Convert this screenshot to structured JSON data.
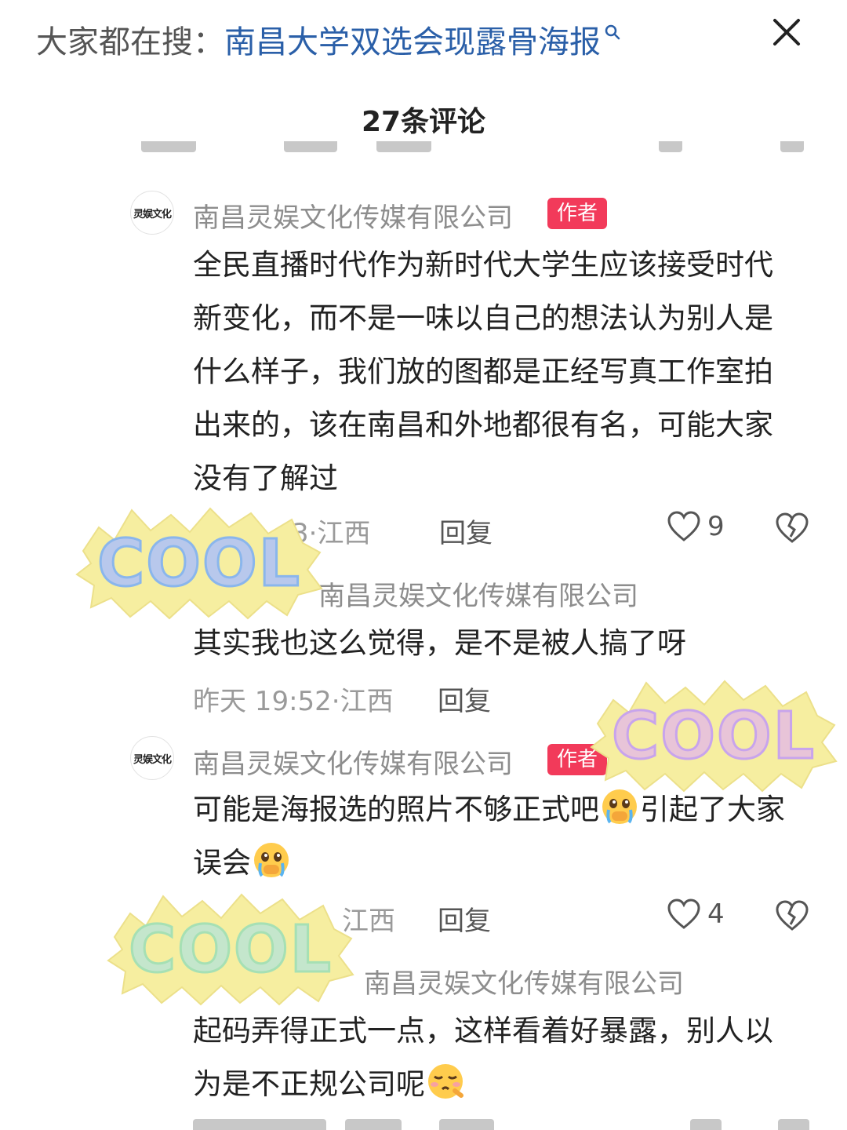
{
  "header": {
    "search_prefix": "大家都在搜：",
    "search_term": "南昌大学双选会现露骨海报",
    "comment_count": "27条评论"
  },
  "comments": [
    {
      "avatar_text": "灵娱文化",
      "username": "南昌灵娱文化传媒有限公司",
      "badge": "作者",
      "text": "全民直播时代作为新时代大学生应该接受时代新变化，而不是一味以自己的想法认为别人是什么样子，我们放的图都是正经写真工作室拍出来的，该在南昌和外地都很有名，可能大家没有了解过",
      "meta": "3·江西",
      "reply": "回复",
      "likes": "9"
    },
    {
      "username": "南昌灵娱文化传媒有限公司",
      "text": "其实我也这么觉得，是不是被人搞了呀",
      "meta": "昨天 19:52·江西",
      "reply": "回复"
    },
    {
      "avatar_text": "灵娱文化",
      "username": "南昌灵娱文化传媒有限公司",
      "badge": "作者",
      "text_a": "可能是海报选的照片不够正式吧",
      "text_b": "引起了大家误会",
      "meta": "江西",
      "reply": "回复",
      "likes": "4"
    },
    {
      "username": "南昌灵娱文化传媒有限公司",
      "text": "起码弄得正式一点，这样看着好暴露，别人以为是不正规公司呢"
    }
  ],
  "stickers": [
    {
      "text": "COOL"
    },
    {
      "text": "COOL"
    },
    {
      "text": "COOL"
    }
  ],
  "colors": {
    "link": "#2a5fa8",
    "badge": "#f23a5a",
    "sticker_bg": "#f6eea0",
    "cool_letters": [
      "#8ab6ec",
      "#eaa8c4",
      "#c8a4ec",
      "#a6e0b4"
    ]
  }
}
